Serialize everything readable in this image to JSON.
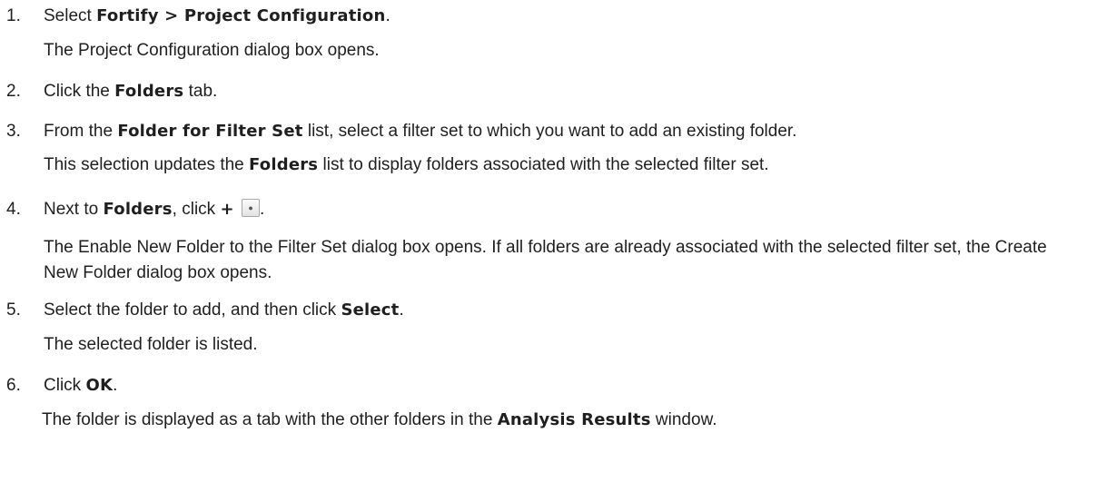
{
  "steps": [
    {
      "num": "1.",
      "pre": "Select ",
      "bold": "Fortify > Project Configuration",
      "post": ".",
      "desc": "The Project Configuration dialog box opens."
    },
    {
      "num": "2.",
      "pre": "Click the ",
      "bold": "Folders",
      "post": " tab."
    },
    {
      "num": "3.",
      "pre": "From the ",
      "bold": "Folder for Filter Set",
      "post": " list, select a filter set to which you want to add an existing folder.",
      "desc_pre": "This selection updates the ",
      "desc_bold": "Folders",
      "desc_post": " list to display folders associated with the selected filter set."
    },
    {
      "num": "4.",
      "pre": "Next to ",
      "bold": "Folders",
      "mid": ", click ",
      "bold2": "+",
      "post": ".",
      "desc": "The Enable New Folder to the Filter Set dialog box opens. If all folders are already associated with the selected filter set, the Create New Folder dialog box opens."
    },
    {
      "num": "5.",
      "pre": "Select the folder to add, and then click ",
      "bold": "Select",
      "post": ".",
      "desc": "The selected folder is listed."
    },
    {
      "num": "6.",
      "pre": "Click ",
      "bold": "OK",
      "post": ".",
      "desc_pre": "The folder is displayed as a tab with the other folders in the ",
      "desc_bold": "Analysis Results",
      "desc_post": " window."
    }
  ],
  "icons": {
    "add_folder": "plus-button-icon"
  }
}
